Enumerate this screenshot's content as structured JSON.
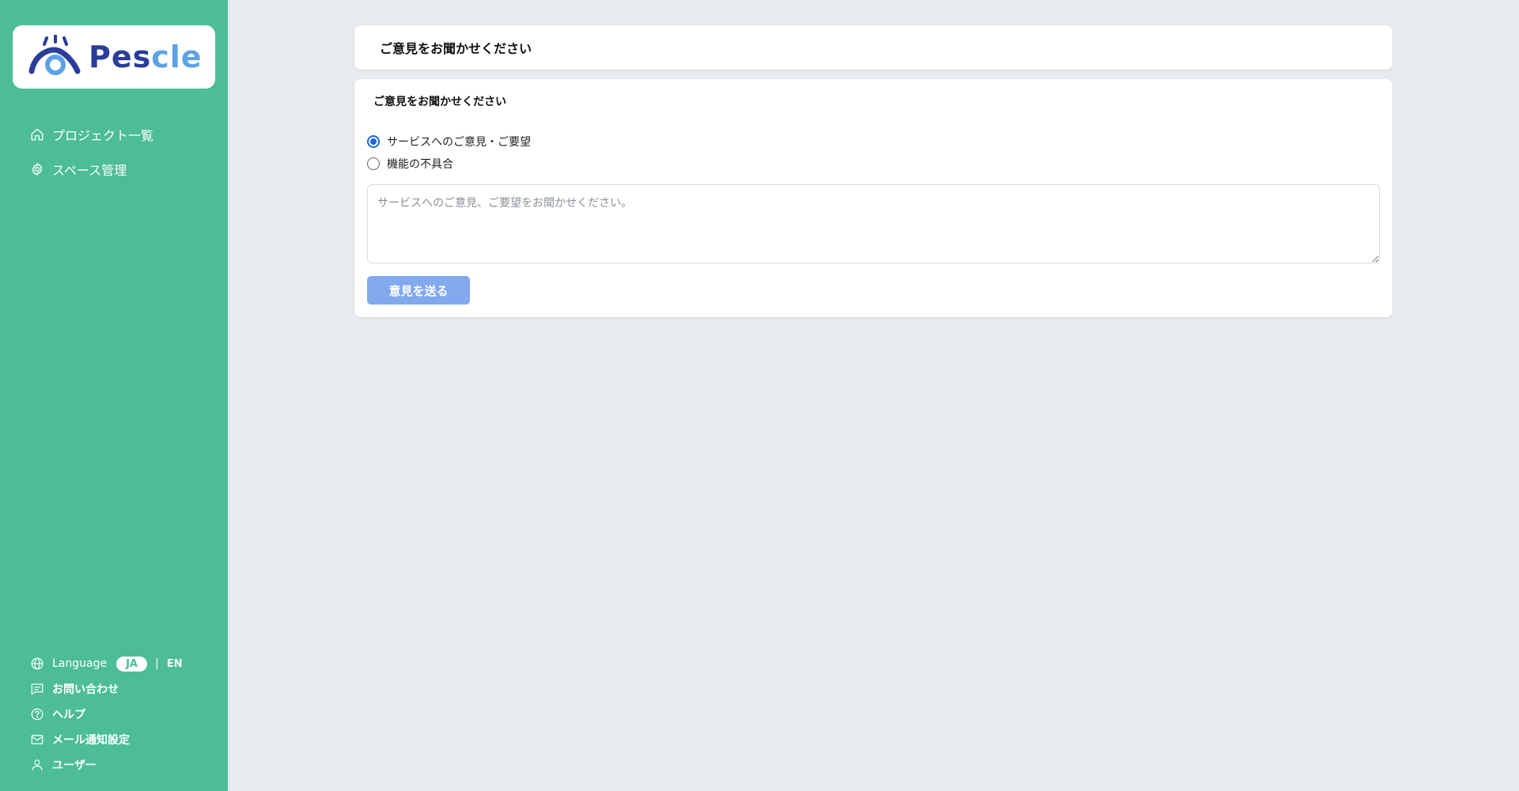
{
  "logo": {
    "text_dark": "Pes",
    "text_light": "cle"
  },
  "sidebar": {
    "nav": [
      {
        "label": "プロジェクト一覧",
        "icon": "home-icon"
      },
      {
        "label": "スペース管理",
        "icon": "gear-icon"
      }
    ],
    "language": {
      "label": "Language",
      "active": "JA",
      "separator": "|",
      "other": "EN"
    },
    "bottom": [
      {
        "label": "お問い合わせ",
        "icon": "message-icon"
      },
      {
        "label": "ヘルプ",
        "icon": "help-icon"
      },
      {
        "label": "メール通知設定",
        "icon": "mail-icon"
      },
      {
        "label": "ユーザー",
        "icon": "user-icon"
      }
    ]
  },
  "header": {
    "title": "ご意見をお聞かせください"
  },
  "form": {
    "title": "ご意見をお聞かせください",
    "options": [
      {
        "label": "サービスへのご意見・ご要望",
        "checked": true
      },
      {
        "label": "機能の不具合",
        "checked": false
      }
    ],
    "textarea": {
      "placeholder": "サービスへのご意見、ご要望をお聞かせください。",
      "value": ""
    },
    "submit_label": "意見を送る"
  },
  "colors": {
    "sidebar": "#4cbd96",
    "background": "#e7eaef",
    "accent": "#1a66e6",
    "submit_disabled": "#82a9ee",
    "logo_dark": "#2a3d9a",
    "logo_light": "#5da2e6"
  }
}
